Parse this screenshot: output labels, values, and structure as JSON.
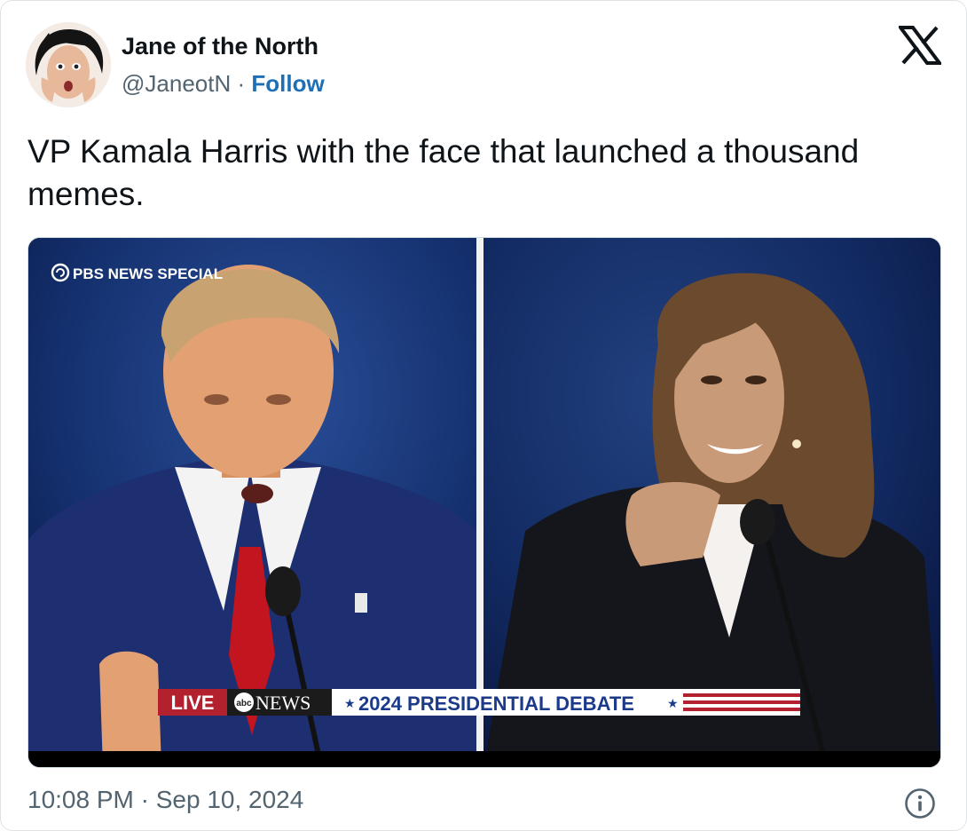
{
  "tweet": {
    "author_name": "Jane of the North",
    "handle": "@JaneotN",
    "separator": "·",
    "follow_label": "Follow",
    "text": "VP Kamala Harris with the face that launched a thousand memes.",
    "timestamp": "10:08 PM · Sep 10, 2024"
  },
  "media": {
    "network_bug": "PBS NEWS SPECIAL",
    "live_label": "LIVE",
    "news_label": "NEWS",
    "network_logo_text": "abc",
    "debate_label": "2024 PRESIDENTIAL DEBATE",
    "star": "★"
  },
  "icons": {
    "platform": "x-logo-icon",
    "info": "info-icon"
  },
  "colors": {
    "follow": "#1d70b8",
    "muted": "#536471",
    "text": "#0f1419",
    "ticker_red": "#b3202e",
    "ticker_blue": "#1c3a8a"
  }
}
